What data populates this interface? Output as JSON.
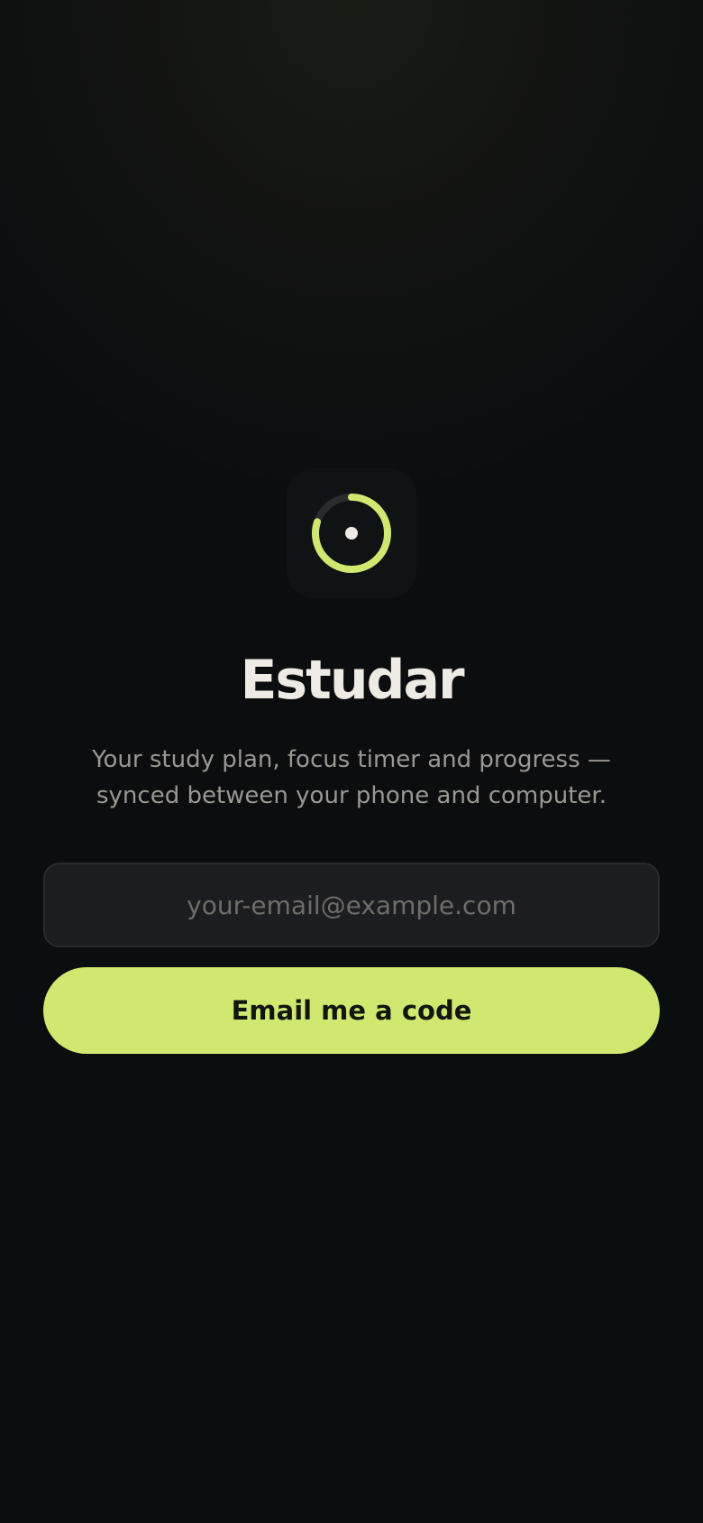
{
  "app": {
    "title": "Estudar",
    "tagline": "Your study plan, focus timer and progress — synced between your phone and computer."
  },
  "logo": {
    "icon": "progress-ring-icon",
    "accent_color": "#d0e870",
    "track_color": "#2a2b2f",
    "center_color": "#eeebe4",
    "progress": 0.8
  },
  "login": {
    "email_value": "",
    "email_placeholder": "your-email@example.com",
    "submit_label": "Email me a code"
  },
  "colors": {
    "background": "#0c0d0f",
    "accent": "#d0e870",
    "text_primary": "#eeebe4",
    "text_secondary": "#9a9893"
  }
}
